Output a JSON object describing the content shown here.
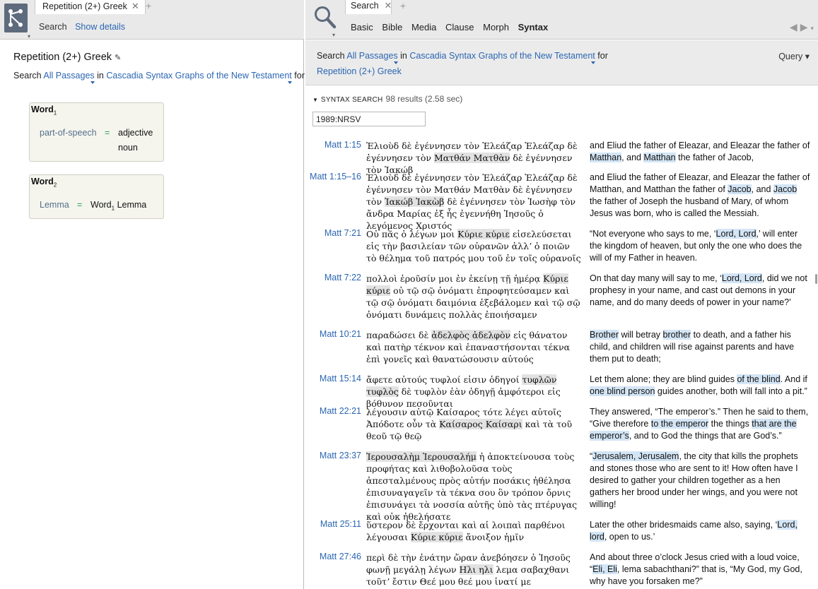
{
  "left": {
    "tab_title": "Repetition (2+) Greek",
    "tab_close": "✕",
    "tab_add": "+",
    "search_label": "Search",
    "show_details": "Show details",
    "query_title": "Repetition (2+) Greek",
    "query_line": {
      "search": "Search",
      "passages": "All Passages",
      "in": "in",
      "resource": "Cascadia Syntax Graphs of the New Testament",
      "for": "for"
    },
    "word1": {
      "title": "Word",
      "sub": "1",
      "key": "part-of-speech",
      "eq": "=",
      "values": [
        "adjective",
        "noun"
      ]
    },
    "word2": {
      "title": "Word",
      "sub": "2",
      "key": "Lemma",
      "eq": "=",
      "value": "Word",
      "value_sub": "1",
      "value_tail": " Lemma"
    }
  },
  "right": {
    "tab_title": "Search",
    "tab_close": "✕",
    "tab_add": "+",
    "modes": [
      "Basic",
      "Bible",
      "Media",
      "Clause",
      "Morph",
      "Syntax"
    ],
    "active_mode": "Syntax",
    "nav_back": "◀",
    "nav_fwd": "▶",
    "query_bar": {
      "search": "Search",
      "passages": "All Passages",
      "in": "in",
      "resource": "Cascadia Syntax Graphs of the New Testament",
      "for": "for",
      "query_name": "Repetition (2+) Greek",
      "query_menu": "Query ▾"
    },
    "section": {
      "caption": "SYNTAX SEARCH",
      "count": "98 results (2.58 sec)"
    },
    "version": "1989:NRSV"
  },
  "results": [
    {
      "ref": "Matt 1:15",
      "greek": [
        [
          "Ἐλιοὺδ δὲ ἐγέννησεν τὸν Ἐλεάζαρ Ἐλεάζαρ δὲ ἐγέννησεν τὸν ",
          false
        ],
        [
          "Ματθάν Ματθὰν",
          true
        ],
        [
          " δὲ ἐγέννησεν τὸν Ἰακώβ",
          false
        ]
      ],
      "english": [
        [
          "and Eliud the father of Eleazar, and Eleazar the father of ",
          false
        ],
        [
          "Matthan",
          true
        ],
        [
          ", and ",
          false
        ],
        [
          "Matthan",
          true
        ],
        [
          " the father of Jacob,",
          false
        ]
      ]
    },
    {
      "ref": "Matt 1:15–16",
      "greek": [
        [
          "Ἐλιοὺδ δὲ ἐγέννησεν τὸν Ἐλεάζαρ Ἐλεάζαρ δὲ ἐγέννησεν τὸν Ματθάν Ματθὰν δὲ ἐγέννησεν τὸν ",
          false
        ],
        [
          "Ἰακώβ Ἰακὼβ",
          true
        ],
        [
          " δὲ ἐγέννησεν τὸν Ἰωσὴφ τὸν ἄνδρα Μαρίας ἐξ ἧς ἐγεννήθη Ἰησοῦς ὁ λεγόμενος Χριστός",
          false
        ]
      ],
      "english": [
        [
          "and Eliud the father of Eleazar, and Eleazar the father of Matthan, and Matthan the father of ",
          false
        ],
        [
          "Jacob",
          true
        ],
        [
          ", and ",
          false
        ],
        [
          "Jacob",
          true
        ],
        [
          " the father of Joseph the husband of Mary, of whom Jesus was born, who is called the Messiah.",
          false
        ]
      ]
    },
    {
      "ref": "Matt 7:21",
      "greek": [
        [
          "Οὐ πᾶς ὁ λέγων μοι ",
          false
        ],
        [
          "Κύριε κύριε",
          true
        ],
        [
          " εἰσελεύσεται εἰς τὴν βασιλείαν τῶν οὐρανῶν ἀλλʼ ὁ ποιῶν τὸ θέλημα τοῦ πατρός μου τοῦ ἐν τοῖς οὐρανοῖς",
          false
        ]
      ],
      "english": [
        [
          "“Not everyone who says to me, ‘",
          false
        ],
        [
          "Lord, Lord",
          true
        ],
        [
          ",’ will enter the kingdom of heaven, but only the one who does the will of my Father in heaven.",
          false
        ]
      ]
    },
    {
      "ref": "Matt 7:22",
      "greek": [
        [
          "πολλοὶ ἐροῦσίν μοι ἐν ἐκείνῃ τῇ ἡμέρᾳ ",
          false
        ],
        [
          "Κύριε κύριε",
          true
        ],
        [
          " οὐ τῷ σῷ ὀνόματι ἐπροφητεύσαμεν καὶ τῷ σῷ ὀνόματι δαιμόνια ἐξεβάλομεν καὶ τῷ σῷ ὀνόματι δυνάμεις πολλὰς ἐποιήσαμεν",
          false
        ]
      ],
      "english": [
        [
          "On that day many will say to me, ‘",
          false
        ],
        [
          "Lord, Lord",
          true
        ],
        [
          ", did we not prophesy in your name, and cast out demons in your name, and do many deeds of power in your name?’",
          false
        ]
      ]
    },
    {
      "ref": "Matt 10:21",
      "greek": [
        [
          "παραδώσει δὲ ",
          false
        ],
        [
          "ἀδελφὸς ἀδελφὸν",
          true
        ],
        [
          " εἰς θάνατον καὶ πατὴρ τέκνον καὶ ἐπαναστήσονται τέκνα ἐπὶ γονεῖς καὶ θανατώσουσιν αὐτούς",
          false
        ]
      ],
      "english": [
        [
          "Brother",
          true
        ],
        [
          " will betray ",
          false
        ],
        [
          "brother",
          true
        ],
        [
          " to death, and a father his child, and children will rise against parents and have them put to death;",
          false
        ]
      ]
    },
    {
      "ref": "Matt 15:14",
      "greek": [
        [
          "ἄφετε αὐτούς τυφλοί εἰσιν ὁδηγοί ",
          false
        ],
        [
          "τυφλῶν τυφλὸς",
          true
        ],
        [
          " δὲ τυφλὸν ἐὰν ὁδηγῇ ἀμφότεροι εἰς βόθυνον πεσοῦνται",
          false
        ]
      ],
      "english": [
        [
          "Let them alone; they are blind guides ",
          false
        ],
        [
          "of the blind",
          true
        ],
        [
          ". And if ",
          false
        ],
        [
          "one blind person",
          true
        ],
        [
          " guides another, both will fall into a pit.”",
          false
        ]
      ]
    },
    {
      "ref": "Matt 22:21",
      "greek": [
        [
          "λέγουσιν αὐτῷ Καίσαρος τότε λέγει αὐτοῖς Ἀπόδοτε οὖν τὰ ",
          false
        ],
        [
          "Καίσαρος Καίσαρι",
          true
        ],
        [
          " καὶ τὰ τοῦ θεοῦ τῷ θεῷ",
          false
        ]
      ],
      "english": [
        [
          "They answered, “The emperor’s.” Then he said to them, “Give therefore ",
          false
        ],
        [
          "to the emperor",
          true
        ],
        [
          " the things ",
          false
        ],
        [
          "that are the emperor’s",
          true
        ],
        [
          ", and to God the things that are God’s.”",
          false
        ]
      ]
    },
    {
      "ref": "Matt 23:37",
      "greek": [
        [
          "Ἰερουσαλὴμ Ἰερουσαλήμ",
          true
        ],
        [
          " ἡ ἀποκτείνουσα τοὺς προφήτας καὶ λιθοβολοῦσα τοὺς ἀπεσταλμένους πρὸς αὐτήν ποσάκις ἠθέλησα ἐπισυναγαγεῖν τὰ τέκνα σου ὃν τρόπον ὄρνις ἐπισυνάγει τὰ νοσσία αὐτῆς ὑπὸ τὰς πτέρυγας καὶ οὐκ ἠθελήσατε",
          false
        ]
      ],
      "english": [
        [
          "“",
          false
        ],
        [
          "Jerusalem, Jerusalem",
          true
        ],
        [
          ", the city that kills the prophets and stones those who are sent to it! How often have I desired to gather your children together as a hen gathers her brood under her wings, and you were not willing!",
          false
        ]
      ]
    },
    {
      "ref": "Matt 25:11",
      "greek": [
        [
          "ὕστερον δὲ ἔρχονται καὶ αἱ λοιπαὶ παρθένοι λέγουσαι ",
          false
        ],
        [
          "Κύριε κύριε",
          true
        ],
        [
          " ἄνοιξον ἡμῖν",
          false
        ]
      ],
      "english": [
        [
          "Later the other bridesmaids came also, saying, ‘",
          false
        ],
        [
          "Lord, lord",
          true
        ],
        [
          ", open to us.’",
          false
        ]
      ]
    },
    {
      "ref": "Matt 27:46",
      "greek": [
        [
          "περὶ δὲ τὴν ἐνάτην ὥραν ἀνεβόησεν ὁ Ἰησοῦς φωνῇ μεγάλῃ λέγων ",
          false
        ],
        [
          "Ηλι ηλι",
          true
        ],
        [
          " λεμα σαβαχθανι τοῦτʼ ἔστιν Θεέ μου θεέ μου ἱνατί με ἐγκατέλιπες",
          false
        ]
      ],
      "english": [
        [
          "And about three o’clock Jesus cried with a loud voice, “",
          false
        ],
        [
          "Eli, Eli",
          true
        ],
        [
          ", lema sabachthani?” that is, “My God, my God, why have you forsaken me?”",
          false
        ]
      ]
    }
  ]
}
